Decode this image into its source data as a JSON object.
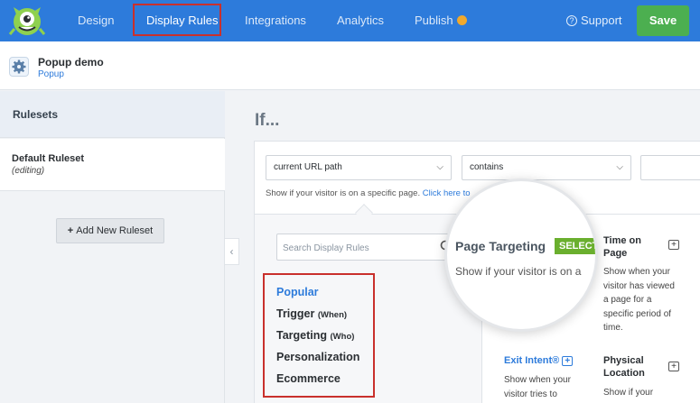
{
  "nav": {
    "items": [
      "Design",
      "Display Rules",
      "Integrations",
      "Analytics",
      "Publish"
    ],
    "support": "Support",
    "save": "Save",
    "colors": {
      "bar": "#2d7bdb",
      "save": "#4caf50",
      "highlight": "#c9302c"
    }
  },
  "campaign": {
    "name": "Popup demo",
    "type": "Popup"
  },
  "sidebar": {
    "heading": "Rulesets",
    "ruleset_name": "Default Ruleset",
    "ruleset_state": "(editing)",
    "add_button": "Add New Ruleset"
  },
  "main": {
    "if_label": "If...",
    "condition": {
      "field": "current URL path",
      "operator": "contains",
      "value": "",
      "hint": "Show if your visitor is on a specific page.",
      "hint_link": "Click here to"
    },
    "search_placeholder": "Search Display Rules",
    "categories": [
      {
        "label": "Popular",
        "sub": ""
      },
      {
        "label": "Trigger",
        "sub": "(When)"
      },
      {
        "label": "Targeting",
        "sub": "(Who)"
      },
      {
        "label": "Personalization",
        "sub": ""
      },
      {
        "label": "Ecommerce",
        "sub": ""
      }
    ],
    "rules": {
      "time_on_page": {
        "title_1": "Time on",
        "title_2": "Page",
        "desc": [
          "Show when your",
          "visitor has viewed",
          "a page for a",
          "specific period of",
          "time."
        ]
      },
      "exit_intent": {
        "title": "Exit Intent®",
        "desc": [
          "Show when your",
          "visitor tries to"
        ]
      },
      "physical_location": {
        "title_1": "Physical",
        "title_2": "Location",
        "desc": [
          "Show if your"
        ]
      }
    },
    "magnifier": {
      "title": "Page Targeting",
      "badge": "SELECTED",
      "desc": "Show if your visitor is on a"
    }
  }
}
